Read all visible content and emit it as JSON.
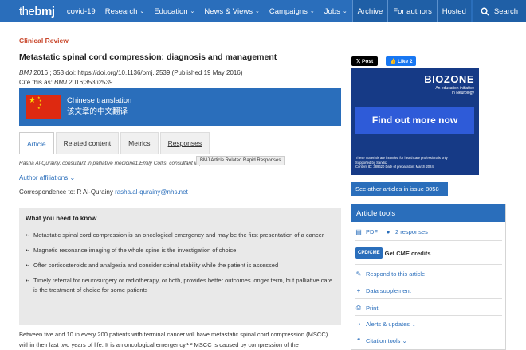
{
  "nav": {
    "logo_the": "the",
    "logo_bmj": "bmj",
    "items": [
      {
        "label": "covid-19",
        "chev": ""
      },
      {
        "label": "Research",
        "chev": "⌄"
      },
      {
        "label": "Education",
        "chev": "⌄"
      },
      {
        "label": "News & Views",
        "chev": "⌄"
      },
      {
        "label": "Campaigns",
        "chev": "⌄"
      },
      {
        "label": "Jobs",
        "chev": "⌄"
      }
    ],
    "archive": "Archive",
    "for_authors": "For authors",
    "hosted": "Hosted",
    "search": "Search"
  },
  "article": {
    "section": "Clinical Review",
    "title": "Metastatic spinal cord compression: diagnosis and management",
    "cite_journal": "BMJ",
    "cite_info": " 2016 ; 353  doi: ",
    "doi": "https://doi.org/10.1136/bmj.i2539",
    "published": " (Published 19 May 2016)",
    "cite_as_label": "Cite this as: ",
    "cite_as_journal": "BMJ",
    "cite_as_ref": " 2016;353:i2539",
    "chinese_label": "Chinese translation",
    "chinese_sub": "该文章的中文翻译",
    "tabs": [
      "Article",
      "Related content",
      "Metrics",
      "Responses"
    ],
    "tooltip": "BMJ Article Related Rapid Responses",
    "authors": "Rasha Al-Qurainy, consultant in palliative medicine1,Emily Collis, consultant in palliative medicine2",
    "affiliations": "Author affiliations",
    "correspondence_label": "Correspondence to: R Al-Qurainy ",
    "correspondence_email": "rasha.al-qurainy@nhs.net",
    "box_title": "What you need to know",
    "bullets": [
      "Metastatic spinal cord compression is an oncological emergency and may be the first presentation of a cancer",
      "Magnetic resonance imaging of the whole spine is the investigation of choice",
      "Offer corticosteroids and analgesia and consider spinal stability while the patient is assessed",
      "Timely referral for neurosurgery or radiotherapy, or both, provides better outcomes longer term, but palliative care is the treatment of choice for some patients"
    ],
    "paragraph": "Between five and 10 in every 200 patients with terminal cancer will have metastatic spinal cord compression (MSCC) within their last two years of life. It is an oncological emergency.¹  ²  MSCC is caused by compression of the"
  },
  "sidebar": {
    "post": "Post",
    "like": "Like 2",
    "ad_brand": "BIOZONE",
    "ad_tag1": "An education initiative",
    "ad_tag2": "in Neurology",
    "ad_button": "Find out more now",
    "ad_fine1": "These materials are intended for healthcare professionals only",
    "ad_fine2": "Supported by Sandoz",
    "ad_fine3": "Content ID: 389620  Date of preparation: March 2024",
    "see_other": "See other articles in issue 8058",
    "tools_title": "Article tools",
    "pdf": "PDF",
    "responses": "2 responses",
    "cpd": "CPD/CME",
    "cme": "Get CME credits",
    "respond": "Respond to this article",
    "data_supp": "Data supplement",
    "print": "Print",
    "alerts": "Alerts & updates",
    "citation": "Citation tools"
  },
  "colors": {
    "brand_blue": "#2a6ebb",
    "accent_red": "#c9472b",
    "ad_navy": "#163a86"
  }
}
